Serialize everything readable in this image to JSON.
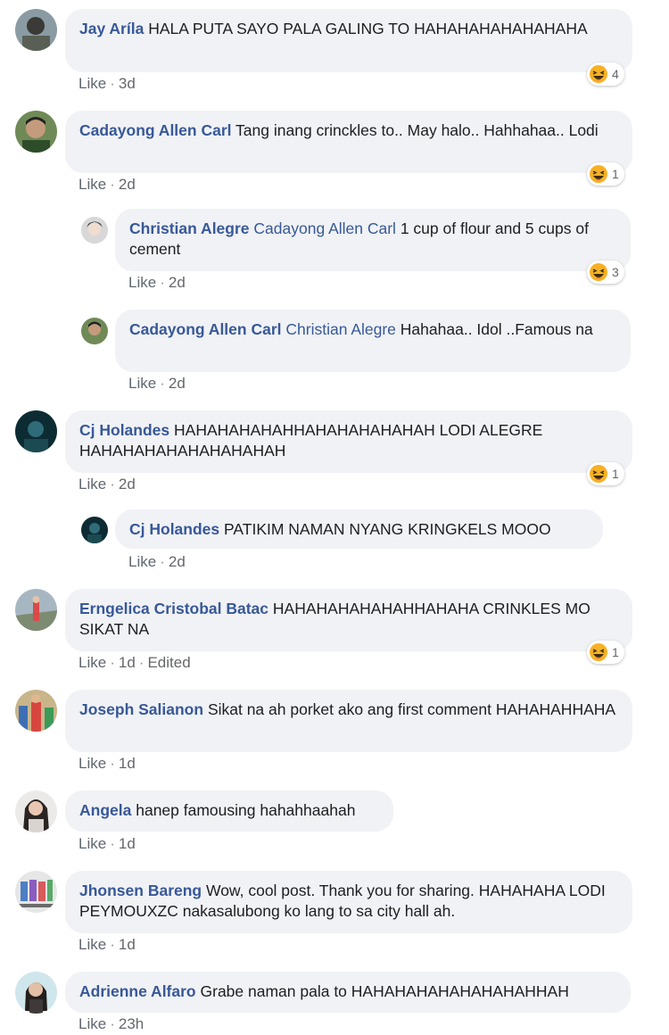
{
  "comments": [
    {
      "author": "Jay Aríla",
      "mention": "",
      "text": "HALA PUTA SAYO PALA GALING TO HAHAHAHAHAHAHAHA",
      "like": "Like",
      "time": "3d",
      "edited": "",
      "reactions": "4"
    },
    {
      "author": "Cadayong Allen Carl",
      "mention": "",
      "text": "Tang inang crinckles to.. May halo.. Hahhahaa.. Lodi",
      "like": "Like",
      "time": "2d",
      "edited": "",
      "reactions": "1"
    },
    {
      "author": "Christian Alegre",
      "mention": "Cadayong Allen Carl",
      "text": "1 cup of flour and 5 cups of cement",
      "like": "Like",
      "time": "2d",
      "edited": "",
      "reactions": "3"
    },
    {
      "author": "Cadayong Allen Carl",
      "mention": "Christian Alegre",
      "text": "Hahahaa.. Idol ..Famous na",
      "like": "Like",
      "time": "2d",
      "edited": "",
      "reactions": ""
    },
    {
      "author": "Cj Holandes",
      "mention": "",
      "text": "HAHAHAHAHAHHAHAHAHAHAHAH LODI ALEGRE HAHAHAHAHAHAHAHAHAH",
      "like": "Like",
      "time": "2d",
      "edited": "",
      "reactions": "1"
    },
    {
      "author": "Cj Holandes",
      "mention": "",
      "text": "PATIKIM NAMAN NYANG KRINGKELS MOOO",
      "like": "Like",
      "time": "2d",
      "edited": "",
      "reactions": ""
    },
    {
      "author": "Erngelica Cristobal Batac",
      "mention": "",
      "text": "HAHAHAHAHAHAHHAHAHA CRINKLES MO SIKAT NA",
      "like": "Like",
      "time": "1d",
      "edited": "Edited",
      "reactions": "1"
    },
    {
      "author": "Joseph Salianon",
      "mention": "",
      "text": "Sikat na ah porket ako ang first comment HAHAHAHHAHA",
      "like": "Like",
      "time": "1d",
      "edited": "",
      "reactions": ""
    },
    {
      "author": "Angela",
      "mention": "",
      "text": "hanep famousing hahahhaahah",
      "like": "Like",
      "time": "1d",
      "edited": "",
      "reactions": ""
    },
    {
      "author": "Jhonsen Bareng",
      "mention": "",
      "text": "Wow, cool post. Thank you for sharing. HAHAHAHA LODI PEYMOUXZC nakasalubong ko lang to sa city hall ah.",
      "like": "Like",
      "time": "1d",
      "edited": "",
      "reactions": ""
    },
    {
      "author": "Adrienne Alfaro",
      "mention": "",
      "text": "Grabe naman pala to HAHAHAHAHAHAHAHAHHAH",
      "like": "Like",
      "time": "23h",
      "edited": "",
      "reactions": ""
    }
  ],
  "meta_separator": "·",
  "reaction_icon": "haha-emoji-icon",
  "colors": {
    "link": "#385898",
    "bubble": "#f0f2f5",
    "meta": "#65676b",
    "emoji": "#f7b125"
  }
}
